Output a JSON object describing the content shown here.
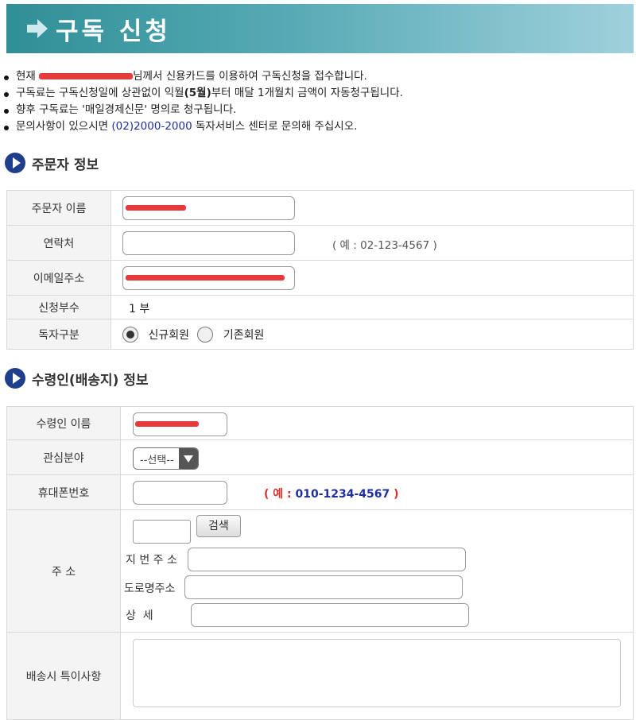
{
  "header": {
    "title": "구독 신청",
    "icon": "arrow-right-icon"
  },
  "notes": {
    "line1": {
      "prefix": "현재 ",
      "suffix": "님께서 신용카드를 이용하여 구독신청을 접수합니다."
    },
    "line2": {
      "prefix": "구독료는 구독신청일에 상관없이 익월",
      "bold": "(5월)",
      "suffix": "부터 매달 1개월치 금액이 자동청구됩니다."
    },
    "line3": "향후 구독료는 '매일경제신문' 명의로 청구됩니다.",
    "line4": {
      "prefix": "문의사항이 있으시면 ",
      "phone": "(02)2000-2000",
      "suffix": " 독자서비스 센터로 문의해 주십시오."
    }
  },
  "orderer": {
    "section_title": "주문자 정보",
    "name_label": "주문자 이름",
    "contact_label": "연락처",
    "contact_hint": "( 예 : 02-123-4567 )",
    "email_label": "이메일주소",
    "count_label": "신청부수",
    "count_value": "1 부",
    "type_label": "독자구분",
    "type_options": [
      "신규회원",
      "기존회원"
    ],
    "type_selected": "신규회원"
  },
  "receiver": {
    "section_title": "수령인(배송지) 정보",
    "name_label": "수령인 이름",
    "interest_label": "관심분야",
    "interest_selected": "--선택--",
    "mobile_label": "휴대폰번호",
    "mobile_hint": {
      "open": "( 예 : ",
      "number": "010-1234-4567",
      "close": " )"
    },
    "address_label": "주 소",
    "search_button": "검색",
    "jibun_label": "지 번 주 소",
    "road_label": "도로명주소",
    "detail_label": "상  세",
    "delivery_note_label": "배송시 특이사항"
  },
  "colors": {
    "banner_start": "#2f8f96",
    "banner_end": "#9fd1dc",
    "redaction": "#e53b3b",
    "phone_blue": "#1d2fa0",
    "hint_red": "#d6322b"
  }
}
